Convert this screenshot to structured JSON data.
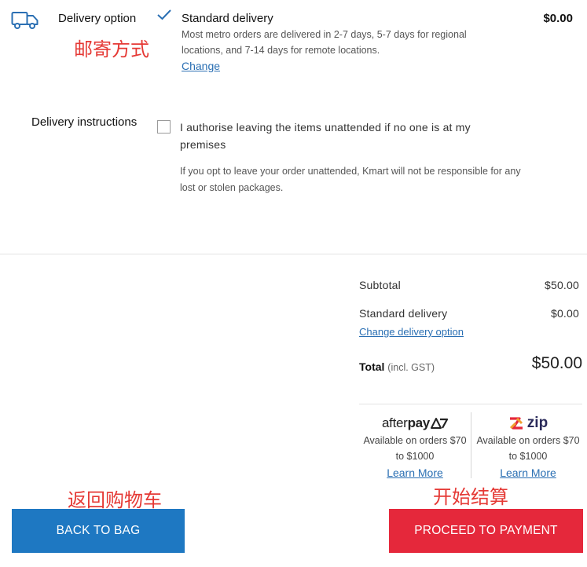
{
  "delivery": {
    "label": "Delivery option",
    "icon": "truck-icon",
    "selected_title": "Standard delivery",
    "description": "Most metro orders are delivered in 2-7 days, 5-7 days for regional locations, and 7-14 days for remote locations.",
    "change_label": "Change",
    "price": "$0.00"
  },
  "annotations": {
    "delivery_method": "邮寄方式",
    "back_to_bag": "返回购物车",
    "start_checkout": "开始结算"
  },
  "instructions": {
    "label": "Delivery instructions",
    "checkbox_label": "I authorise leaving the items unattended if no one is at my premises",
    "checked": false,
    "note": "If you opt to leave your order unattended, Kmart will not be responsible for any lost or stolen packages."
  },
  "summary": {
    "subtotal_label": "Subtotal",
    "subtotal_value": "$50.00",
    "delivery_label": "Standard delivery",
    "delivery_value": "$0.00",
    "change_delivery_label": "Change delivery option",
    "total_label": "Total",
    "total_sub": "(incl. GST)",
    "total_value": "$50.00"
  },
  "payments": [
    {
      "brand": "afterpay",
      "brand_text_a": "after",
      "brand_text_b": "pay",
      "availability": "Available on orders $70 to $1000",
      "learn_more": "Learn More"
    },
    {
      "brand": "zip",
      "brand_text": "zip",
      "availability": "Available on orders $70 to $1000",
      "learn_more": "Learn More"
    }
  ],
  "buttons": {
    "back": "BACK TO BAG",
    "proceed": "PROCEED TO PAYMENT"
  },
  "colors": {
    "link": "#2a6fb3",
    "back_button": "#1e78c2",
    "proceed_button": "#e5283b",
    "annotation": "#e53935"
  }
}
